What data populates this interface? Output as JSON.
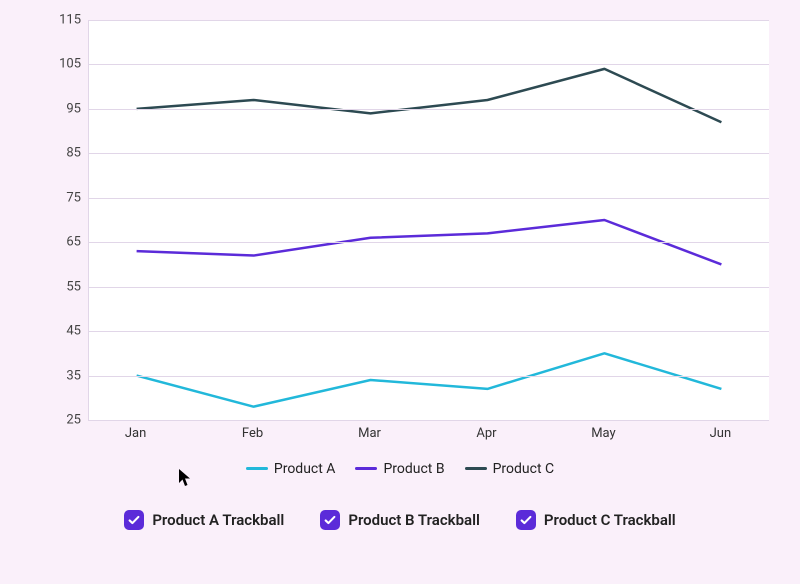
{
  "chart_data": {
    "type": "line",
    "categories": [
      "Jan",
      "Feb",
      "Mar",
      "Apr",
      "May",
      "Jun"
    ],
    "series": [
      {
        "name": "Product A",
        "color": "#22b8da",
        "values": [
          35,
          28,
          34,
          32,
          40,
          32
        ]
      },
      {
        "name": "Product B",
        "color": "#5b2bd9",
        "values": [
          63,
          62,
          66,
          67,
          70,
          60
        ]
      },
      {
        "name": "Product C",
        "color": "#2d4a52",
        "values": [
          95,
          97,
          94,
          97,
          104,
          92
        ]
      }
    ],
    "ylim": [
      25,
      115
    ],
    "yticks": [
      25,
      35,
      45,
      55,
      65,
      75,
      85,
      95,
      105,
      115
    ],
    "title": "",
    "xlabel": "",
    "ylabel": ""
  },
  "legend": {
    "items": [
      {
        "label": "Product A"
      },
      {
        "label": "Product B"
      },
      {
        "label": "Product C"
      }
    ]
  },
  "trackball": {
    "items": [
      {
        "label": "Product A Trackball",
        "checked": true
      },
      {
        "label": "Product B Trackball",
        "checked": true
      },
      {
        "label": "Product C Trackball",
        "checked": true
      }
    ],
    "check_color": "#5b2bd9"
  }
}
